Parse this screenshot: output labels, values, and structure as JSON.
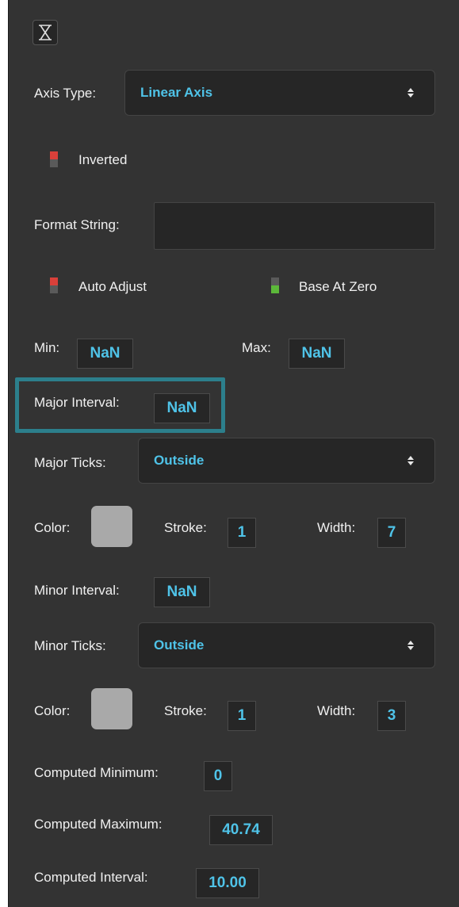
{
  "axis_type": {
    "label": "Axis Type:",
    "value": "Linear Axis"
  },
  "inverted": {
    "label": "Inverted",
    "on": false
  },
  "format_string": {
    "label": "Format String:",
    "value": ""
  },
  "auto_adjust": {
    "label": "Auto Adjust",
    "on": false
  },
  "base_at_zero": {
    "label": "Base At Zero",
    "on": true
  },
  "min": {
    "label": "Min:",
    "value": "NaN"
  },
  "max": {
    "label": "Max:",
    "value": "NaN"
  },
  "major_interval": {
    "label": "Major Interval:",
    "value": "NaN"
  },
  "major_ticks": {
    "label": "Major Ticks:",
    "value": "Outside",
    "color_label": "Color:",
    "color": "#a9a9a9",
    "stroke_label": "Stroke:",
    "stroke": "1",
    "width_label": "Width:",
    "width": "7"
  },
  "minor_interval": {
    "label": "Minor Interval:",
    "value": "NaN"
  },
  "minor_ticks": {
    "label": "Minor Ticks:",
    "value": "Outside",
    "color_label": "Color:",
    "color": "#a9a9a9",
    "stroke_label": "Stroke:",
    "stroke": "1",
    "width_label": "Width:",
    "width": "3"
  },
  "computed_minimum": {
    "label": "Computed Minimum:",
    "value": "0"
  },
  "computed_maximum": {
    "label": "Computed Maximum:",
    "value": "40.74"
  },
  "computed_interval": {
    "label": "Computed Interval:",
    "value": "10.00"
  },
  "colors": {
    "accent": "#4fc3e8",
    "panel_bg": "#333333",
    "field_bg": "#262626",
    "toggle_off": "#d9403a",
    "toggle_on": "#5cb83a",
    "toggle_inactive": "#5a5a5a",
    "highlight": "#2c7f8c"
  }
}
